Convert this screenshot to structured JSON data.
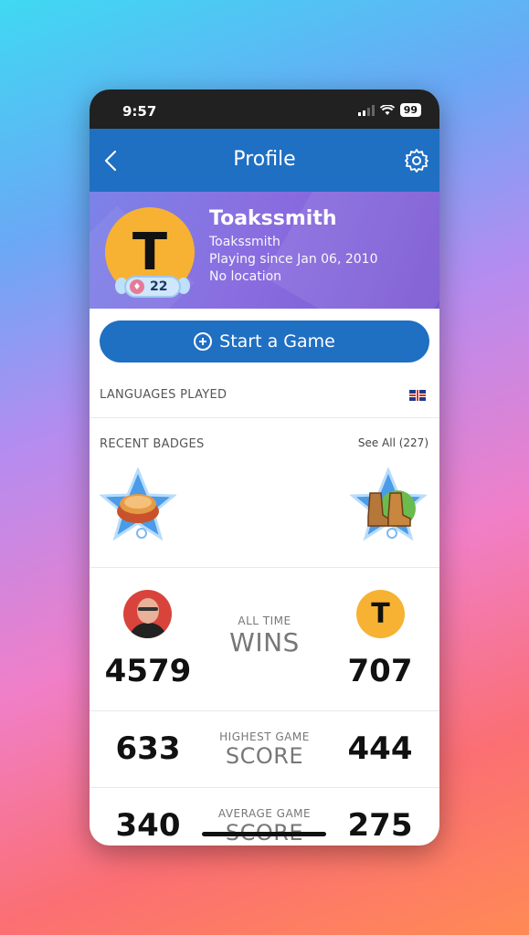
{
  "status": {
    "time": "9:57",
    "battery": "99"
  },
  "nav": {
    "title": "Profile"
  },
  "profile": {
    "initial": "T",
    "display_name": "Toakssmith",
    "username": "Toakssmith",
    "playing_since": "Playing since Jan 06, 2010",
    "location": "No location",
    "level": "22"
  },
  "start_game_label": "Start a Game",
  "languages": {
    "label": "LANGUAGES PLAYED",
    "flag_icon": "uk-flag-icon"
  },
  "badges": {
    "label": "RECENT BADGES",
    "see_all": "See All (227)",
    "items": [
      "casserole-badge-icon",
      "hiking-boots-badge-icon"
    ]
  },
  "stats": [
    {
      "small": "ALL TIME",
      "big": "WINS",
      "left": "4579",
      "right": "707"
    },
    {
      "small": "HIGHEST GAME",
      "big": "SCORE",
      "left": "633",
      "right": "444"
    },
    {
      "small": "AVERAGE GAME",
      "big": "SCORE",
      "left": "340",
      "right": "275"
    }
  ],
  "opponent_initial": "T",
  "colors": {
    "brand_blue": "#1f6fc3",
    "avatar_yellow": "#f7b233",
    "header_purple": "#8a6ee0"
  }
}
